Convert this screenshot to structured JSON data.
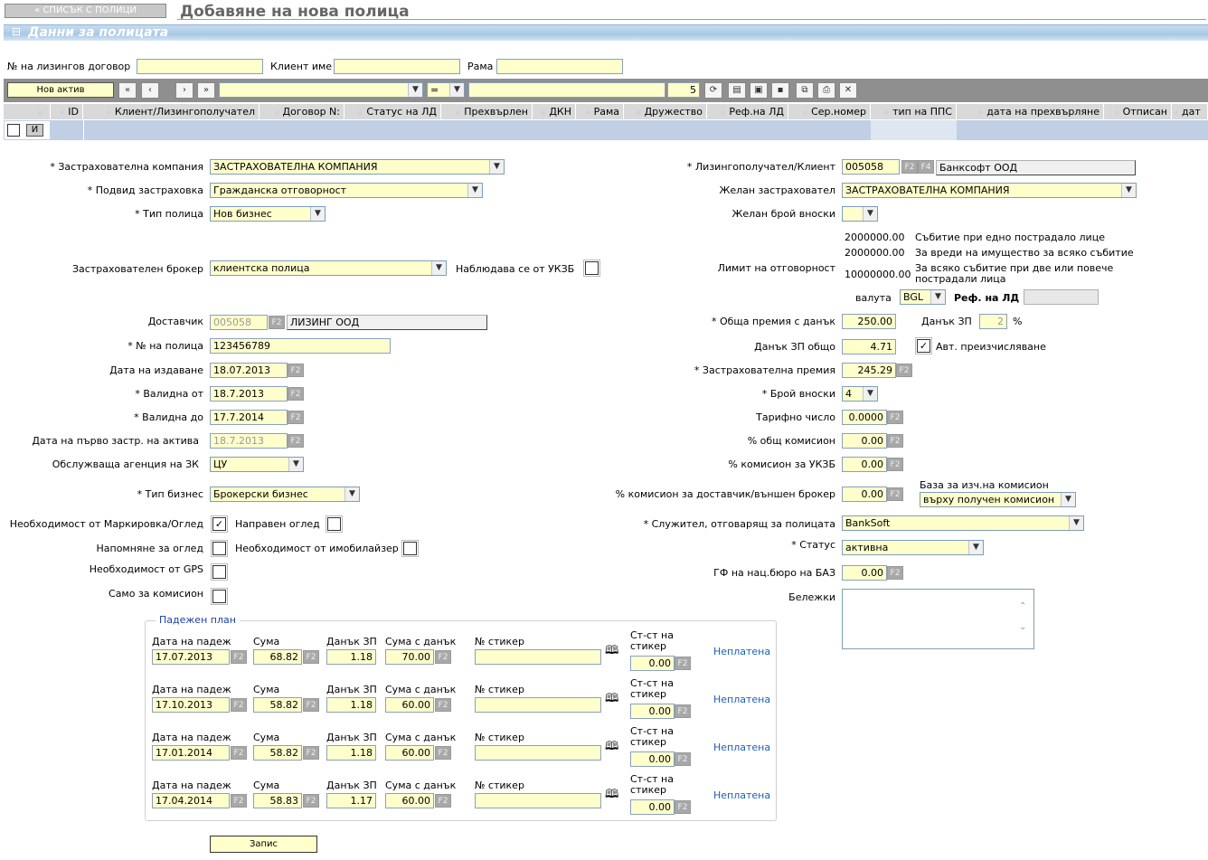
{
  "top": {
    "back_button": "« СПИСЪК С ПОЛИЦИ",
    "page_title": "Добавяне на нова полица",
    "section_title": "Данни за полицата",
    "collapse_symbol": "⊟"
  },
  "filters": {
    "leasing_contract_label": "№ на лизингов договор",
    "leasing_contract_value": "",
    "client_name_label": "Клиент име",
    "client_name_value": "",
    "frame_label": "Рама",
    "frame_value": ""
  },
  "toolbar": {
    "new_asset": "Нов актив",
    "operator": "=",
    "page_size": "5"
  },
  "grid": {
    "columns": [
      "ID",
      "Клиент/Лизингополучател",
      "Договор N:",
      "Статус на ЛД",
      "Прехвърлен",
      "ДКН",
      "Рама",
      "Дружество",
      "Реф.на ЛД",
      "Сер.номер",
      "тип на ППС",
      "дата на прехвърляне",
      "Отписан",
      "дат"
    ],
    "row_button": "И"
  },
  "left": {
    "ins_company_label": "* Застрахователна компания",
    "ins_company_value": "ЗАСТРАХОВАТЕЛНА КОМПАНИЯ",
    "subtype_label": "* Подвид застраховка",
    "subtype_value": "Гражданска отговорност",
    "policy_type_label": "* Тип полица",
    "policy_type_value": "Нов бизнес",
    "broker_label": "Застрахователен брокер",
    "broker_value": "клиентска полица",
    "ukzb_label": "Наблюдава се от УКЗБ",
    "supplier_label": "Доставчик",
    "supplier_code": "005058",
    "supplier_name": "ЛИЗИНГ ООД",
    "policy_no_label": "* № на полица",
    "policy_no_value": "123456789",
    "issue_date_label": "Дата на издаване",
    "issue_date_value": "18.07.2013",
    "valid_from_label": "* Валидна от",
    "valid_from_value": "18.7.2013",
    "valid_to_label": "* Валидна до",
    "valid_to_value": "17.7.2014",
    "first_ins_label": "Дата на първо застр. на актива",
    "first_ins_value": "18.7.2013",
    "agency_label": "Обслужваща агенция на ЗК",
    "agency_value": "ЦУ",
    "business_type_label": "* Тип бизнес",
    "business_type_value": "Брокерски бизнес",
    "marking_label": "Необходимост от Маркировка/Оглед",
    "inspection_done_label": "Направен оглед",
    "reminder_label": "Напомняне за оглед",
    "immobilizer_label": "Необходимост от имобилайзер",
    "gps_label": "Необходимост от GPS",
    "commission_only_label": "Само за комисион",
    "f2": "F2",
    "f4": "F4"
  },
  "right": {
    "lessee_label": "* Лизингополучател/Клиент",
    "lessee_code": "005058",
    "lessee_name": "Банксофт ООД",
    "desired_insurer_label": "Желан застраховател",
    "desired_insurer_value": "ЗАСТРАХОВАТЕЛНА КОМПАНИЯ",
    "desired_installments_label": "Желан брой вноски",
    "limit_label": "Лимит на отговорност",
    "limits": [
      {
        "amount": "2000000.00",
        "text": "Събитие при едно пострадало лице"
      },
      {
        "amount": "2000000.00",
        "text": "За вреди на имущество за всяко събитие"
      },
      {
        "amount": "10000000.00",
        "text": "За всяко събитие при две или повече пострадали лица"
      }
    ],
    "currency_label": "валута",
    "currency_value": "BGL",
    "ref_ld_label": "Реф. на ЛД",
    "total_premium_label": "* Обща премия с данък",
    "total_premium_value": "250.00",
    "tax_label": "Данък ЗП",
    "tax_pct_value": "2",
    "pct": "%",
    "tax_total_label": "Данък ЗП общо",
    "tax_total_value": "4.71",
    "auto_calc_label": "Авт. преизчисляване",
    "ins_premium_label": "* Застрахователна премия",
    "ins_premium_value": "245.29",
    "installments_label": "* Брой вноски",
    "installments_value": "4",
    "tariff_label": "Тарифно число",
    "tariff_value": "0.0000",
    "total_commission_label": "% общ комисион",
    "total_commission_value": "0.00",
    "ukzb_commission_label": "% комисион за УКЗБ",
    "ukzb_commission_value": "0.00",
    "supplier_commission_label": "% комисион за доставчик/външен брокер",
    "supplier_commission_value": "0.00",
    "commission_base_label": "База за изч.на комисион",
    "commission_base_value": "върху получен комисион",
    "employee_label": "* Служител, отговарящ за полицата",
    "employee_value": "BankSoft",
    "status_label": "* Статус",
    "status_value": "активна",
    "gf_label": "ГФ на нац.бюро на БАЗ",
    "gf_value": "0.00",
    "notes_label": "Бележки"
  },
  "plan": {
    "title": "Падежен план",
    "due_label": "Дата на падеж",
    "sum_label": "Сума",
    "tax_label": "Данък ЗП",
    "sum_tax_label": "Сума с данък",
    "sticker_label": "№ стикер",
    "sticker_value_label": "Ст-ст на стикер",
    "rows": [
      {
        "date": "17.07.2013",
        "sum": "68.82",
        "tax": "1.18",
        "sum_tax": "70.00",
        "sticker_value": "0.00",
        "status": "Неплатена"
      },
      {
        "date": "17.10.2013",
        "sum": "58.82",
        "tax": "1.18",
        "sum_tax": "60.00",
        "sticker_value": "0.00",
        "status": "Неплатена"
      },
      {
        "date": "17.01.2014",
        "sum": "58.82",
        "tax": "1.18",
        "sum_tax": "60.00",
        "sticker_value": "0.00",
        "status": "Неплатена"
      },
      {
        "date": "17.04.2014",
        "sum": "58.83",
        "tax": "1.17",
        "sum_tax": "60.00",
        "sticker_value": "0.00",
        "status": "Неплатена"
      }
    ]
  },
  "save_button": "Запис"
}
